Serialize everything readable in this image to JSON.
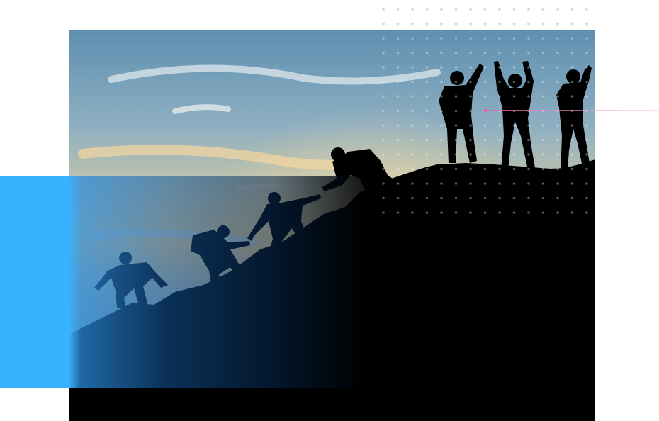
{
  "scene": {
    "subject": "climbers-on-mountain",
    "colors": {
      "accent_blue": "#38b2ff",
      "accent_pink": "#e85fa8",
      "dot_gray": "#d4d4d8",
      "sky_top": "#6d97b4",
      "sky_horizon": "#e8c98c",
      "silhouette": "#000000"
    }
  }
}
